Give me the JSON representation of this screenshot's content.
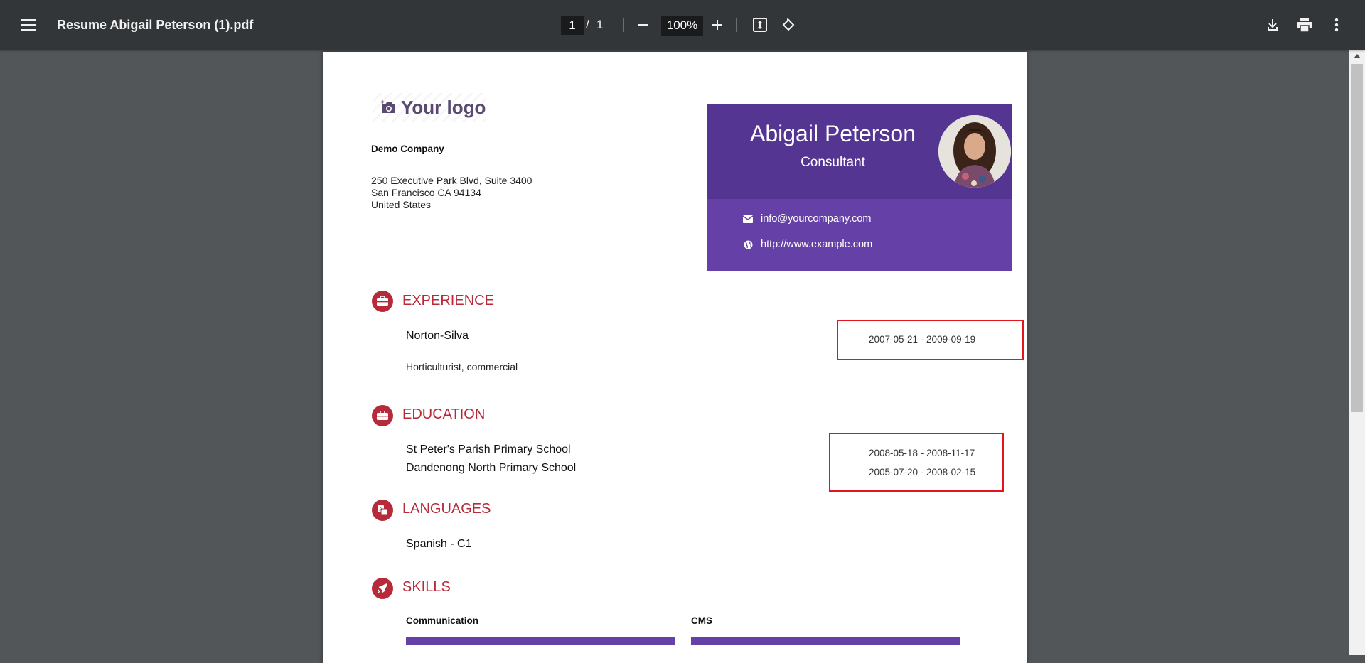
{
  "viewer": {
    "title": "Resume Abigail Peterson (1).pdf",
    "current_page": "1",
    "page_separator": "/",
    "total_pages": "1",
    "zoom": "100%"
  },
  "document": {
    "logo_text": "Your logo",
    "company": {
      "name": "Demo Company",
      "address_lines": [
        "250 Executive Park Blvd, Suite 3400",
        "San Francisco CA 94134",
        "United States"
      ]
    },
    "candidate": {
      "name": "Abigail Peterson",
      "job_title": "Consultant",
      "email": "info@yourcompany.com",
      "website": "http://www.example.com"
    },
    "sections": {
      "experience": {
        "title": "EXPERIENCE",
        "entries": [
          {
            "name": "Norton-Silva",
            "description": "Horticulturist, commercial",
            "dates": "2007-05-21 - 2009-09-19"
          }
        ]
      },
      "education": {
        "title": "EDUCATION",
        "entries": [
          {
            "name": "St Peter's Parish Primary School",
            "dates": "2008-05-18 - 2008-11-17"
          },
          {
            "name": "Dandenong North Primary School",
            "dates": "2005-07-20 - 2008-02-15"
          }
        ]
      },
      "languages": {
        "title": "LANGUAGES",
        "entries": [
          {
            "name": "Spanish - C1"
          }
        ]
      },
      "skills": {
        "title": "SKILLS",
        "entries": [
          {
            "name": "Communication",
            "level": 1.0
          },
          {
            "name": "CMS",
            "level": 1.0
          }
        ]
      }
    }
  },
  "colors": {
    "toolbar": "#323639",
    "viewer_background": "#525659",
    "accent_red": "#b72a3a",
    "purple_dark": "#553592",
    "purple_light": "#6540a6",
    "highlight_box": "#e3141e"
  }
}
